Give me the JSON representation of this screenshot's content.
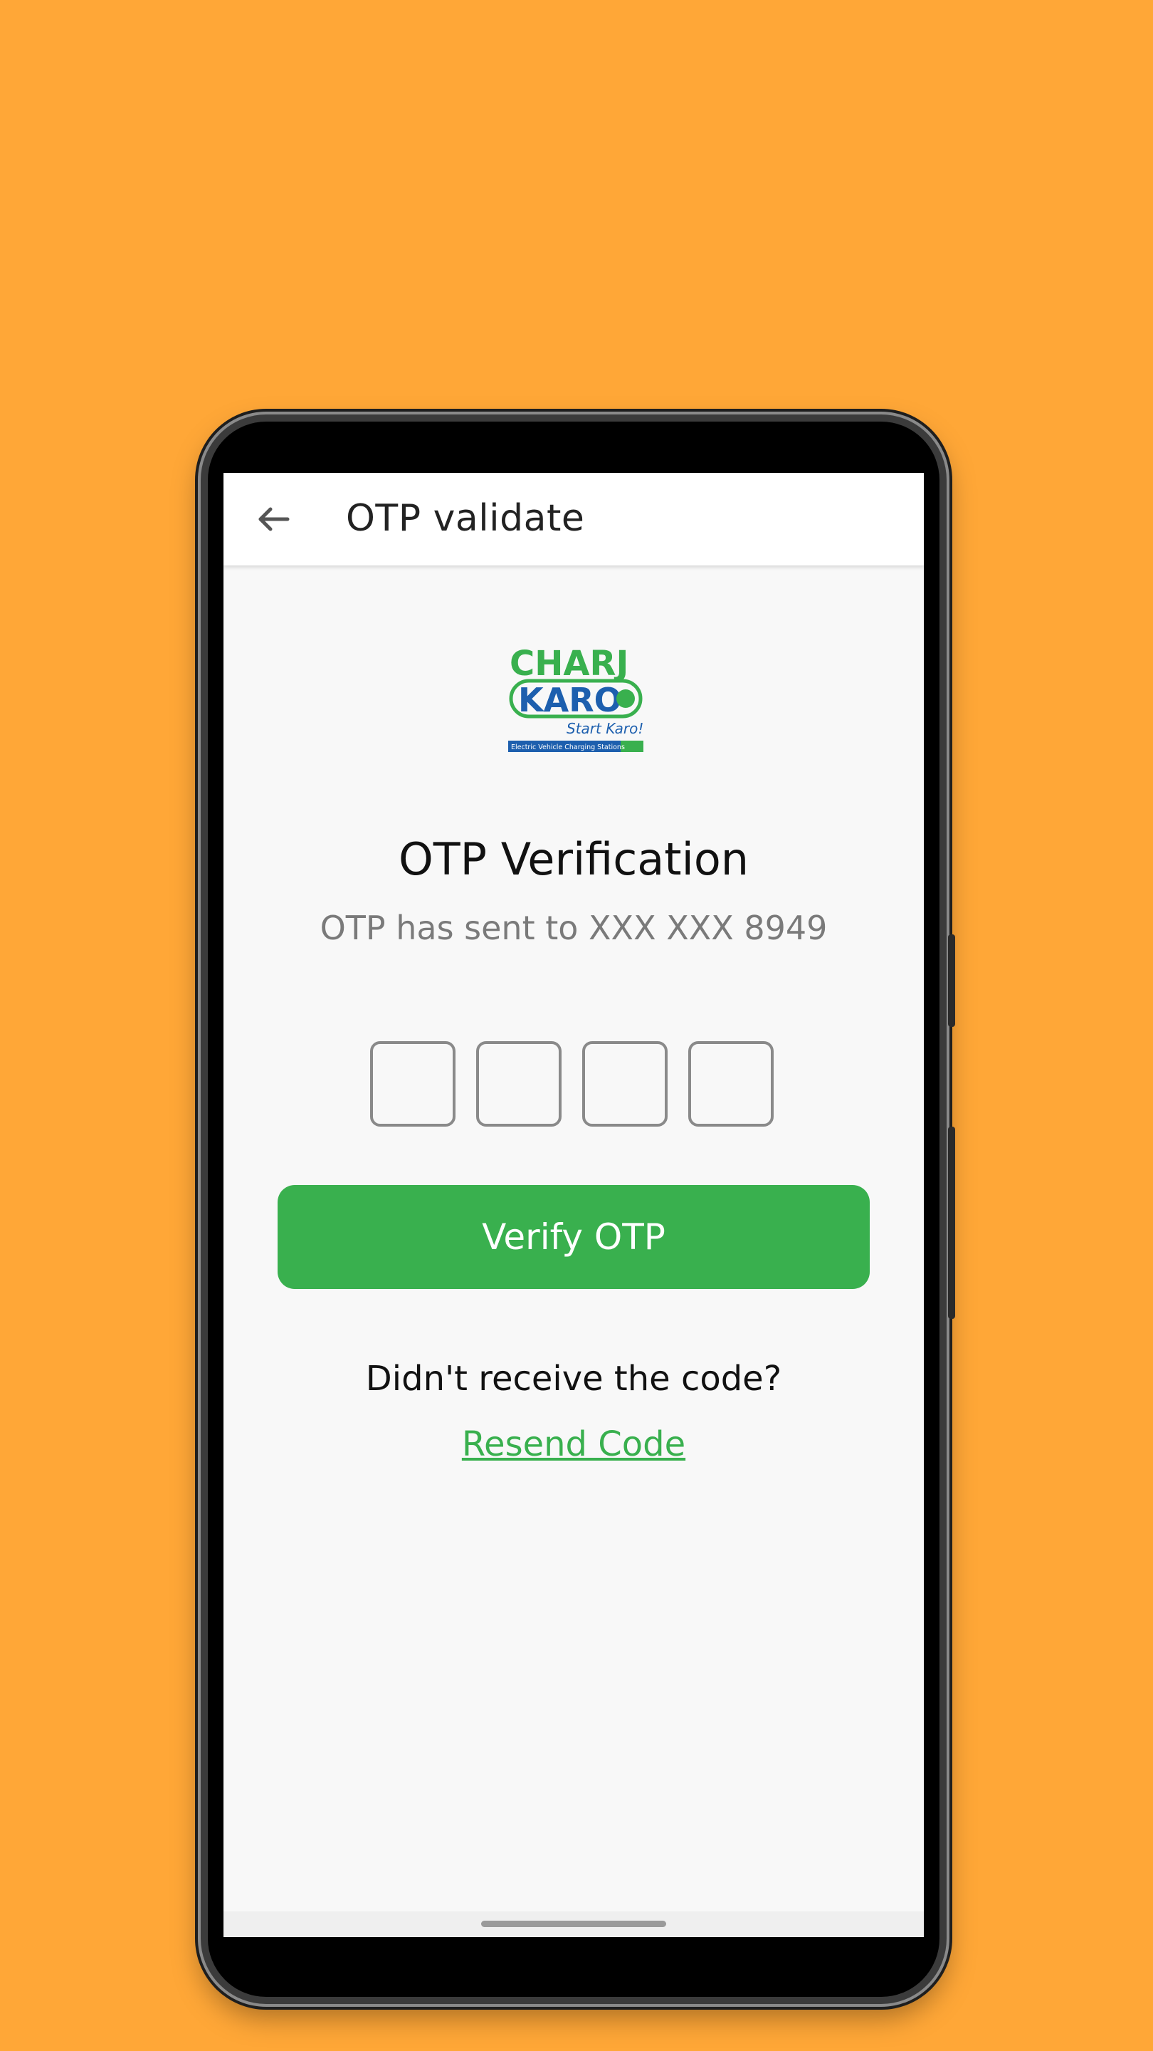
{
  "appbar": {
    "title": "OTP validate"
  },
  "logo": {
    "line1": "CHARJ",
    "line2": "KARO",
    "tagline": "Start Karo!",
    "banner": "Electric Vehicle Charging Stations"
  },
  "verification": {
    "heading": "OTP Verification",
    "subtext": "OTP has sent to XXX XXX 8949",
    "otp_digits": [
      "",
      "",
      "",
      ""
    ],
    "verify_label": "Verify OTP",
    "question": "Didn't receive the code?",
    "resend_label": "Resend Code"
  },
  "colors": {
    "background": "#FFA737",
    "accent": "#39B04E",
    "logo_blue": "#1D5FAE"
  },
  "icons": {
    "back": "arrow-left-icon"
  }
}
